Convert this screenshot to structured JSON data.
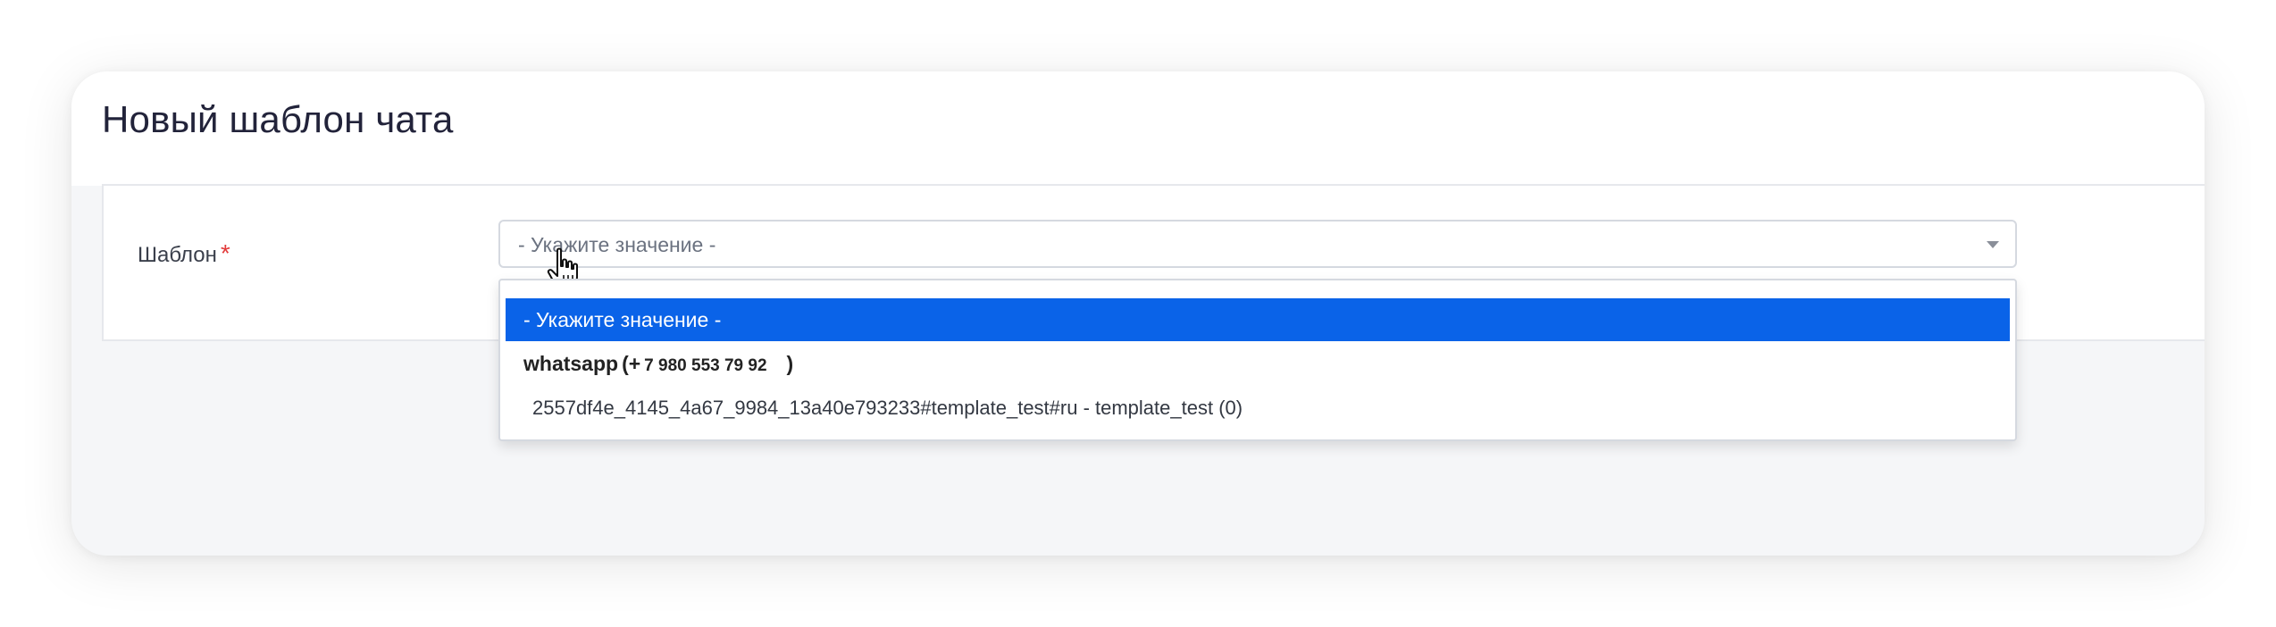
{
  "page": {
    "title": "Новый шаблон чата"
  },
  "form": {
    "field_label": "Шаблон",
    "required_mark": "*",
    "select": {
      "current_value": "- Укажите значение -"
    }
  },
  "dropdown": {
    "selected_option": "- Укажите значение -",
    "group": {
      "name": "whatsapp",
      "open_paren": "(+",
      "phone": "7 980 553 79 92",
      "close_paren": ")"
    },
    "options": [
      "2557df4e_4145_4a67_9984_13a40e793233#template_test#ru - template_test (0)"
    ]
  },
  "icons": {
    "cursor": "hand-pointer-icon",
    "arrow": "chevron-down-icon"
  },
  "colors": {
    "accent": "#0a63e8",
    "required": "#e23a3a",
    "title": "#22233a"
  }
}
